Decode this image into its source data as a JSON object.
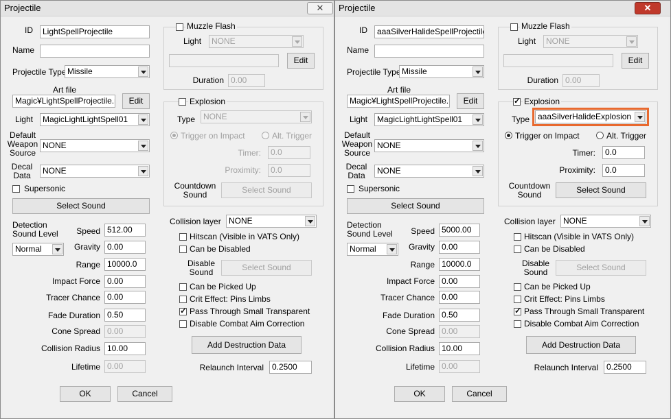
{
  "windows": [
    {
      "title": "Projectile",
      "close": "✕",
      "id_label": "ID",
      "id_value": "LightSpellProjectile",
      "name_label": "Name",
      "name_value": "",
      "type_label": "Projectile Type",
      "type_value": "Missile",
      "art_label": "Art file",
      "art_value": "Magic¥LightSpellProjectile.nif",
      "art_edit": "Edit",
      "light_label": "Light",
      "light_value": "MagicLightLightSpell01",
      "weapon_label_1": "Default",
      "weapon_label_2": "Weapon",
      "weapon_label_3": "Source",
      "weapon_value": "NONE",
      "decal_label_1": "Decal",
      "decal_label_2": "Data",
      "decal_value": "NONE",
      "supersonic": "Supersonic",
      "select_sound": "Select Sound",
      "detection_label_1": "Detection",
      "detection_label_2": "Sound Level",
      "detection_value": "Normal",
      "speed_label": "Speed",
      "speed": "512.00",
      "gravity_label": "Gravity",
      "gravity": "0.00",
      "range_label": "Range",
      "range": "10000.0",
      "impact_label": "Impact Force",
      "impact": "0.00",
      "tracer_label": "Tracer Chance",
      "tracer": "0.00",
      "fade_label": "Fade Duration",
      "fade": "0.50",
      "cone_label": "Cone Spread",
      "cone": "0.00",
      "radius_label": "Collision Radius",
      "radius": "10.00",
      "lifetime_label": "Lifetime",
      "lifetime": "0.00",
      "muzzle_label": "Muzzle Flash",
      "muzzle_light_label": "Light",
      "muzzle_light_value": "NONE",
      "muzzle_edit": "Edit",
      "duration_label": "Duration",
      "duration": "0.00",
      "explosion_label": "Explosion",
      "explosion_type_label": "Type",
      "explosion_type_value": "NONE",
      "trigger_impact": "Trigger on Impact",
      "alt_trigger": "Alt. Trigger",
      "timer_label": "Timer:",
      "timer": "0.0",
      "proximity_label": "Proximity:",
      "proximity": "0.0",
      "countdown_1": "Countdown",
      "countdown_2": "Sound",
      "countdown_select": "Select Sound",
      "collision_label": "Collision layer",
      "collision_value": "NONE",
      "hitscan": "Hitscan (Visible in VATS Only)",
      "can_disable": "Can be Disabled",
      "disable_sound_1": "Disable",
      "disable_sound_2": "Sound",
      "disable_select": "Select Sound",
      "picked_up": "Can be Picked Up",
      "crit": "Crit Effect: Pins Limbs",
      "pass_through": "Pass Through Small Transparent",
      "disable_aim": "Disable Combat Aim Correction",
      "add_destruction": "Add Destruction Data",
      "relaunch_label": "Relaunch Interval",
      "relaunch": "0.2500",
      "ok": "OK",
      "cancel": "Cancel"
    },
    {
      "title": "Projectile",
      "close": "✕",
      "id_label": "ID",
      "id_value": "aaaSilverHalideSpellProjectile",
      "name_label": "Name",
      "name_value": "",
      "type_label": "Projectile Type",
      "type_value": "Missile",
      "art_label": "Art file",
      "art_value": "Magic¥LightSpellProjectile.nif",
      "art_edit": "Edit",
      "light_label": "Light",
      "light_value": "MagicLightLightSpell01",
      "weapon_label_1": "Default",
      "weapon_label_2": "Weapon",
      "weapon_label_3": "Source",
      "weapon_value": "NONE",
      "decal_label_1": "Decal",
      "decal_label_2": "Data",
      "decal_value": "NONE",
      "supersonic": "Supersonic",
      "select_sound": "Select Sound",
      "detection_label_1": "Detection",
      "detection_label_2": "Sound Level",
      "detection_value": "Normal",
      "speed_label": "Speed",
      "speed": "5000.00",
      "gravity_label": "Gravity",
      "gravity": "0.00",
      "range_label": "Range",
      "range": "10000.0",
      "impact_label": "Impact Force",
      "impact": "0.00",
      "tracer_label": "Tracer Chance",
      "tracer": "0.00",
      "fade_label": "Fade Duration",
      "fade": "0.50",
      "cone_label": "Cone Spread",
      "cone": "0.00",
      "radius_label": "Collision Radius",
      "radius": "10.00",
      "lifetime_label": "Lifetime",
      "lifetime": "0.00",
      "muzzle_label": "Muzzle Flash",
      "muzzle_light_label": "Light",
      "muzzle_light_value": "NONE",
      "muzzle_edit": "Edit",
      "duration_label": "Duration",
      "duration": "0.00",
      "explosion_label": "Explosion",
      "explosion_type_label": "Type",
      "explosion_type_value": "aaaSilverHalideExplosion",
      "trigger_impact": "Trigger on Impact",
      "alt_trigger": "Alt. Trigger",
      "timer_label": "Timer:",
      "timer": "0.0",
      "proximity_label": "Proximity:",
      "proximity": "0.0",
      "countdown_1": "Countdown",
      "countdown_2": "Sound",
      "countdown_select": "Select Sound",
      "collision_label": "Collision layer",
      "collision_value": "NONE",
      "hitscan": "Hitscan (Visible in VATS Only)",
      "can_disable": "Can be Disabled",
      "disable_sound_1": "Disable",
      "disable_sound_2": "Sound",
      "disable_select": "Select Sound",
      "picked_up": "Can be Picked Up",
      "crit": "Crit Effect: Pins Limbs",
      "pass_through": "Pass Through Small Transparent",
      "disable_aim": "Disable Combat Aim Correction",
      "add_destruction": "Add Destruction Data",
      "relaunch_label": "Relaunch Interval",
      "relaunch": "0.2500",
      "ok": "OK",
      "cancel": "Cancel"
    }
  ],
  "checkbox_states": {
    "muzzle_flash": [
      false,
      false
    ],
    "explosion": [
      false,
      true
    ],
    "supersonic": [
      false,
      false
    ],
    "hitscan": [
      false,
      false
    ],
    "can_disable": [
      false,
      false
    ],
    "picked_up": [
      false,
      false
    ],
    "crit": [
      false,
      false
    ],
    "pass_through": [
      true,
      true
    ],
    "disable_aim": [
      false,
      false
    ]
  },
  "highlight_color": "#e8692e"
}
